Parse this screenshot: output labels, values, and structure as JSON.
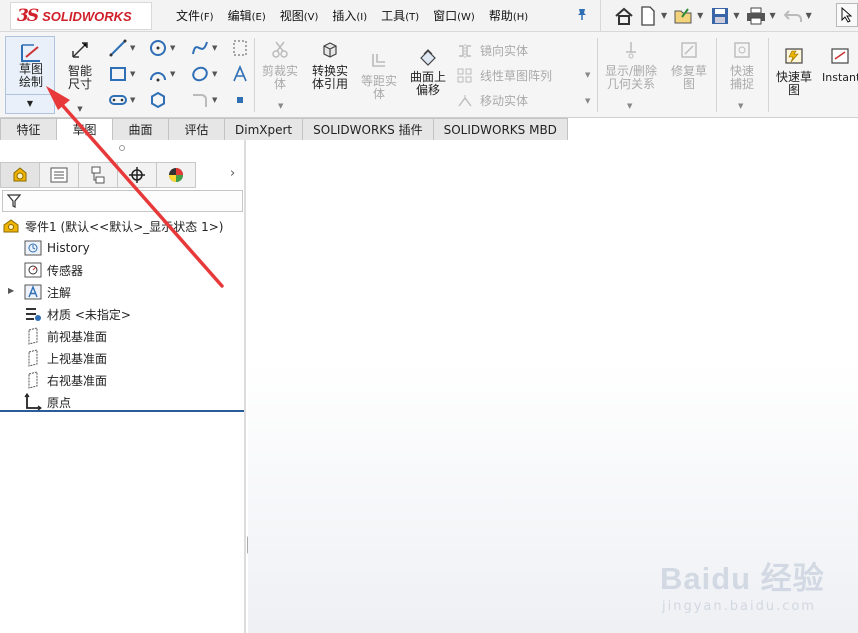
{
  "app": {
    "logo_ds": "3S",
    "logo_text": "SOLIDWORKS"
  },
  "menu": [
    {
      "label": "文件",
      "key": "(F)"
    },
    {
      "label": "编辑",
      "key": "(E)"
    },
    {
      "label": "视图",
      "key": "(V)"
    },
    {
      "label": "插入",
      "key": "(I)"
    },
    {
      "label": "工具",
      "key": "(T)"
    },
    {
      "label": "窗口",
      "key": "(W)"
    },
    {
      "label": "帮助",
      "key": "(H)"
    }
  ],
  "command_manager": {
    "sketch": "草图绘制",
    "smart_dimension": "智能尺寸",
    "trim": "剪裁实体",
    "convert": "转换实体引用",
    "offset": "等距实体",
    "surface_offset": "曲面上偏移",
    "mirror": "镜向实体",
    "linear_pattern": "线性草图阵列",
    "move": "移动实体",
    "relations": "显示/删除几何关系",
    "repair": "修复草图",
    "quick_snaps": "快速捕捉",
    "rapid_sketch": "快速草图",
    "instant": "Instant"
  },
  "tabs": [
    {
      "label": "特征"
    },
    {
      "label": "草图"
    },
    {
      "label": "曲面"
    },
    {
      "label": "评估"
    },
    {
      "label": "DimXpert"
    },
    {
      "label": "SOLIDWORKS 插件"
    },
    {
      "label": "SOLIDWORKS MBD"
    }
  ],
  "feature_tree": {
    "part": "零件1 (默认<<默认>_显示状态 1>)",
    "items": [
      {
        "label": "History",
        "icon": "history-icon"
      },
      {
        "label": "传感器",
        "icon": "sensor-icon"
      },
      {
        "label": "注解",
        "icon": "annotation-icon"
      },
      {
        "label": "材质 <未指定>",
        "icon": "material-icon"
      },
      {
        "label": "前视基准面",
        "icon": "plane-icon"
      },
      {
        "label": "上视基准面",
        "icon": "plane-icon"
      },
      {
        "label": "右视基准面",
        "icon": "plane-icon"
      },
      {
        "label": "原点",
        "icon": "origin-icon"
      }
    ]
  },
  "watermark": {
    "main": "Baidu 经验",
    "sub": "jingyan.baidu.com"
  },
  "colors": {
    "brand": "#d0202a",
    "annotation_arrow": "#e8393a",
    "tree_separator": "#2b5c9a"
  }
}
